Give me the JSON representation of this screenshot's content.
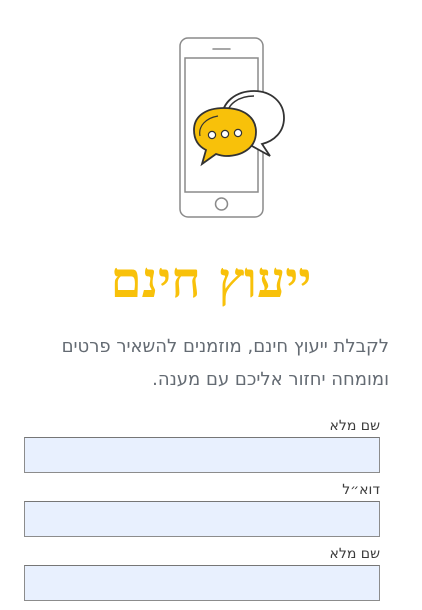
{
  "hero": {
    "illustration_icon": "phone-chat-bubbles-icon",
    "accent_color": "#f8c10a",
    "title": "ייעוץ חינם"
  },
  "intro": {
    "line1": "לקבלת ייעוץ חינם, מוזמנים להשאיר פרטים",
    "line2": "ומומחה יחזור אליכם עם מענה."
  },
  "form": {
    "fields": [
      {
        "label": "שם מלא",
        "value": ""
      },
      {
        "label": "דוא״ל",
        "value": ""
      },
      {
        "label": "שם מלא",
        "value": ""
      }
    ]
  }
}
